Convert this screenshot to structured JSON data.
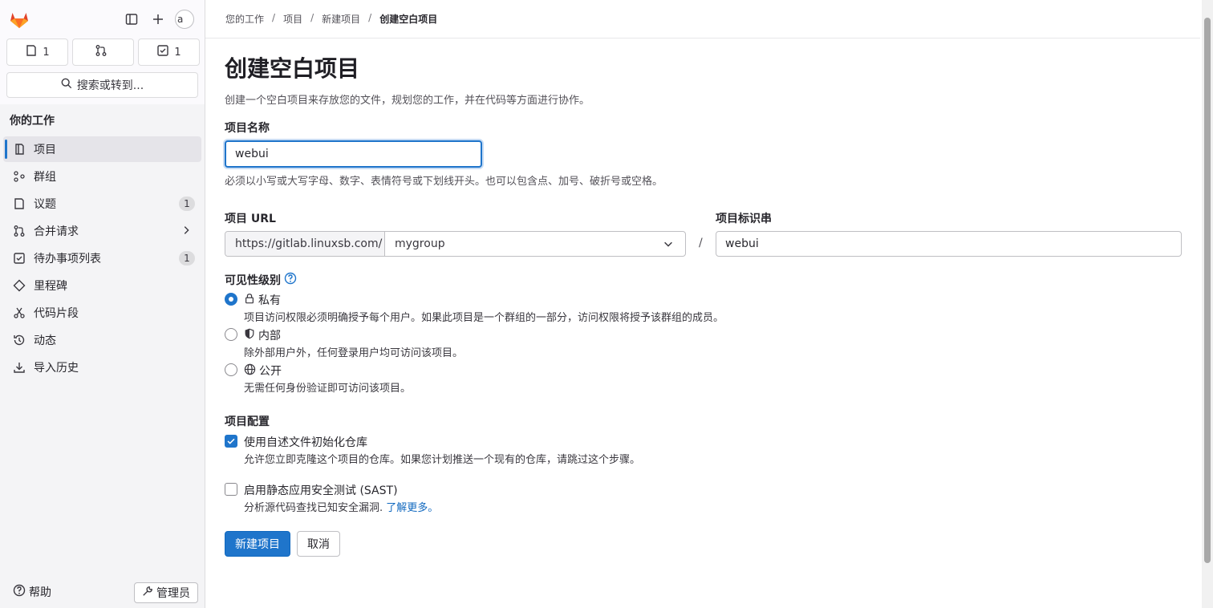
{
  "sidebar": {
    "avatar_alt": "a",
    "counters": [
      {
        "icon": "issues-icon",
        "count": "1"
      },
      {
        "icon": "merge-request-icon",
        "count": ""
      },
      {
        "icon": "todo-icon",
        "count": "1"
      }
    ],
    "search_label": "搜索或转到...",
    "section_title": "你的工作",
    "items": [
      {
        "label": "项目",
        "icon": "project-icon",
        "active": true
      },
      {
        "label": "群组",
        "icon": "group-icon"
      },
      {
        "label": "议题",
        "icon": "issues-icon",
        "badge": "1"
      },
      {
        "label": "合并请求",
        "icon": "merge-request-icon",
        "chevron": true
      },
      {
        "label": "待办事项列表",
        "icon": "todo-icon",
        "badge": "1"
      },
      {
        "label": "里程碑",
        "icon": "milestone-icon"
      },
      {
        "label": "代码片段",
        "icon": "snippet-icon"
      },
      {
        "label": "动态",
        "icon": "activity-icon"
      },
      {
        "label": "导入历史",
        "icon": "import-icon"
      }
    ],
    "help_label": "帮助",
    "admin_label": "管理员"
  },
  "breadcrumb": [
    "您的工作",
    "项目",
    "新建项目",
    "创建空白项目"
  ],
  "page": {
    "title": "创建空白项目",
    "description": "创建一个空白项目来存放您的文件，规划您的工作，并在代码等方面进行协作。"
  },
  "form": {
    "name_label": "项目名称",
    "name_value": "webui",
    "name_help": "必须以小写或大写字母、数字、表情符号或下划线开头。也可以包含点、加号、破折号或空格。",
    "url_label": "项目 URL",
    "url_prefix": "https://gitlab.linuxsb.com/",
    "url_namespace": "mygroup",
    "slash": "/",
    "slug_label": "项目标识串",
    "slug_value": "webui",
    "visibility_label": "可见性级别",
    "visibility": [
      {
        "title": "私有",
        "desc": "项目访问权限必须明确授予每个用户。如果此项目是一个群组的一部分，访问权限将授予该群组的成员。",
        "checked": true
      },
      {
        "title": "内部",
        "desc": "除外部用户外，任何登录用户均可访问该项目。",
        "checked": false
      },
      {
        "title": "公开",
        "desc": "无需任何身份验证即可访问该项目。",
        "checked": false
      }
    ],
    "config_label": "项目配置",
    "readme_label": "使用自述文件初始化仓库",
    "readme_desc": "允许您立即克隆这个项目的仓库。如果您计划推送一个现有的仓库，请跳过这个步骤。",
    "sast_label": "启用静态应用安全测试 (SAST)",
    "sast_desc": "分析源代码查找已知安全漏洞.",
    "sast_link": "了解更多。",
    "submit_label": "新建项目",
    "cancel_label": "取消"
  },
  "colors": {
    "accent": "#1f75cb",
    "link": "#1068bf"
  }
}
